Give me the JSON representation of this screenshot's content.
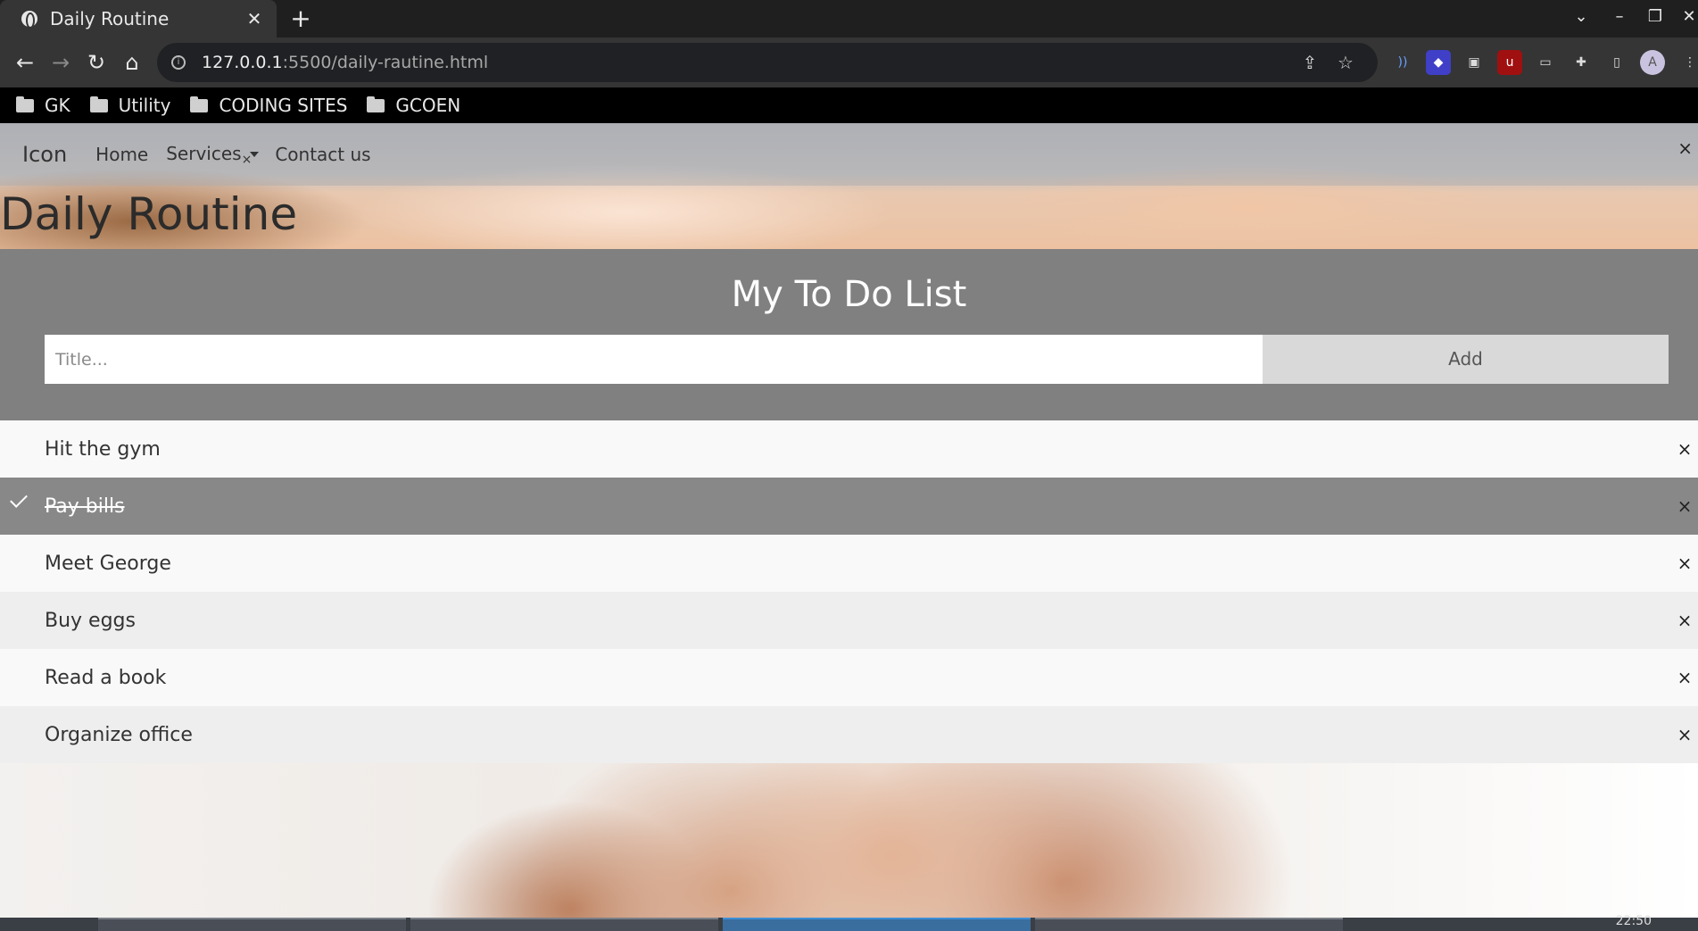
{
  "browser": {
    "tab_title": "Daily Routine",
    "tab_close": "✕",
    "new_tab": "+",
    "url_host": "127.0.0.1",
    "url_path": ":5500/daily-rautine.html",
    "bookmarks": [
      "GK",
      "Utility",
      "CODING SITES",
      "GCOEN"
    ]
  },
  "navbar": {
    "brand": "Icon",
    "links": [
      "Home",
      "Services",
      "Contact us"
    ],
    "close": "×"
  },
  "hero": {
    "title": "Daily Routine"
  },
  "todo": {
    "title": "My To Do List",
    "input_placeholder": "Title...",
    "add_label": "Add",
    "items": [
      {
        "text": "Hit the gym",
        "checked": false
      },
      {
        "text": "Pay bills",
        "checked": true
      },
      {
        "text": "Meet George",
        "checked": false
      },
      {
        "text": "Buy eggs",
        "checked": false
      },
      {
        "text": "Read a book",
        "checked": false
      },
      {
        "text": "Organize office",
        "checked": false
      }
    ],
    "close_symbol": "×"
  },
  "taskbar": {
    "clock": "22:50"
  }
}
